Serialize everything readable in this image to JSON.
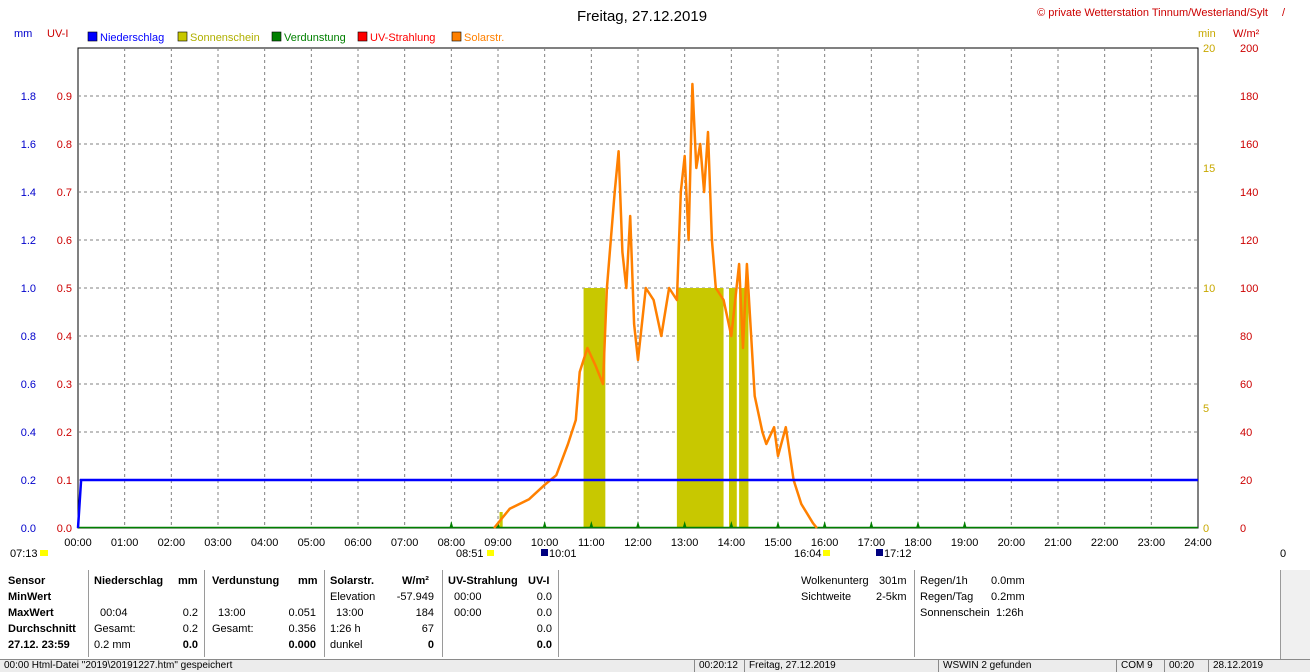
{
  "title": "Freitag, 27.12.2019",
  "copyright": "© private Wetterstation Tinnum/Westerland/Sylt",
  "corner_marker": "/",
  "axis_units": {
    "left1": "mm",
    "left2": "UV-I",
    "right1": "min",
    "right2": "W/m²"
  },
  "legend": [
    {
      "label": "Niederschlag",
      "color": "#0000ff"
    },
    {
      "label": "Sonnenschein",
      "color": "#c8c800"
    },
    {
      "label": "Verdunstung",
      "color": "#008000"
    },
    {
      "label": "UV-Strahlung",
      "color": "#ff0000"
    },
    {
      "label": "Solarstr.",
      "color": "#ff8000"
    }
  ],
  "sun_markers": {
    "left": "07:13",
    "right": "0",
    "sunrise": "08:51",
    "uv_start": "10:01",
    "sunset": "16:04",
    "uv_end": "17:12"
  },
  "chart_data": {
    "type": "line",
    "x_ticks": [
      "00:00",
      "01:00",
      "02:00",
      "03:00",
      "04:00",
      "05:00",
      "06:00",
      "07:00",
      "08:00",
      "09:00",
      "10:00",
      "11:00",
      "12:00",
      "13:00",
      "14:00",
      "15:00",
      "16:00",
      "17:00",
      "18:00",
      "19:00",
      "20:00",
      "21:00",
      "22:00",
      "23:00",
      "24:00"
    ],
    "y_mm_ticks": [
      "0.0",
      "0.2",
      "0.4",
      "0.6",
      "0.8",
      "1.0",
      "1.2",
      "1.4",
      "1.6",
      "1.8"
    ],
    "y_uv_ticks": [
      "0.0",
      "0.1",
      "0.2",
      "0.3",
      "0.4",
      "0.5",
      "0.6",
      "0.7",
      "0.8",
      "0.9"
    ],
    "y_min_ticks": [
      "0",
      "5",
      "10",
      "15",
      "20"
    ],
    "y_wm2_ticks": [
      "0",
      "20",
      "40",
      "60",
      "80",
      "100",
      "120",
      "140",
      "160",
      "180",
      "200"
    ],
    "ylim_mm": [
      0,
      2.0
    ],
    "ylim_uv": [
      0,
      1.0
    ],
    "ylim_min": [
      0,
      20
    ],
    "ylim_wm2": [
      0,
      200
    ],
    "grid": true,
    "series": [
      {
        "name": "Niederschlag",
        "color": "#0000ff",
        "x": [
          "00:00",
          "00:04",
          "24:00"
        ],
        "y": [
          0.0,
          0.2,
          0.2
        ]
      },
      {
        "name": "Solarstr.",
        "color": "#ff8000",
        "x": [
          "08:55",
          "09:15",
          "09:40",
          "10:00",
          "10:15",
          "10:30",
          "10:40",
          "10:45",
          "10:55",
          "11:05",
          "11:15",
          "11:20",
          "11:30",
          "11:35",
          "11:40",
          "11:45",
          "11:50",
          "11:55",
          "12:00",
          "12:10",
          "12:20",
          "12:30",
          "12:40",
          "12:50",
          "12:55",
          "13:00",
          "13:05",
          "13:10",
          "13:15",
          "13:20",
          "13:25",
          "13:30",
          "13:35",
          "13:40",
          "13:50",
          "14:00",
          "14:10",
          "14:15",
          "14:20",
          "14:30",
          "14:40",
          "14:45",
          "14:55",
          "15:00",
          "15:10",
          "15:20",
          "15:30",
          "15:45",
          "15:50"
        ],
        "y": [
          0,
          8,
          12,
          18,
          22,
          35,
          45,
          65,
          75,
          68,
          60,
          100,
          140,
          157,
          115,
          100,
          130,
          85,
          70,
          100,
          95,
          80,
          100,
          95,
          140,
          155,
          120,
          185,
          150,
          160,
          140,
          165,
          120,
          100,
          95,
          80,
          110,
          75,
          110,
          55,
          40,
          35,
          42,
          30,
          42,
          20,
          10,
          2,
          0
        ]
      },
      {
        "name": "Sonnenschein",
        "color": "#c8c800",
        "blocks": [
          [
            "10:50",
            "11:18"
          ],
          [
            "12:50",
            "13:50"
          ],
          [
            "13:57",
            "14:07"
          ],
          [
            "14:10",
            "14:22"
          ],
          [
            "09:02",
            "09:06"
          ]
        ],
        "value_min": 10
      },
      {
        "name": "Verdunstung",
        "color": "#008000",
        "x": [
          "00:00",
          "08:45",
          "09:15",
          "24:00"
        ],
        "y": [
          0.0,
          0.0,
          0.0,
          0.0
        ]
      }
    ]
  },
  "stats": {
    "sensor": {
      "title": "Sensor",
      "rows": [
        "MinWert",
        "MaxWert",
        "Durchschnitt",
        "27.12.  23:59"
      ]
    },
    "niederschlag": {
      "title": "Niederschlag",
      "unit": "mm",
      "r1a": "",
      "r1b": "",
      "r2a": "00:04",
      "r2b": "0.2",
      "r3a": "Gesamt:",
      "r3b": "0.2",
      "r4a": "0.2 mm",
      "r4b": "0.0"
    },
    "verdunstung": {
      "title": "Verdunstung",
      "unit": "mm",
      "r1a": "",
      "r1b": "",
      "r2a": "13:00",
      "r2b": "0.051",
      "r3a": "Gesamt:",
      "r3b": "0.356",
      "r4a": "",
      "r4b": "0.000"
    },
    "solar": {
      "title": "Solarstr.",
      "unit": "W/m²",
      "r1a": "Elevation",
      "r1b": "-57.949",
      "r2a": "13:00",
      "r2b": "184",
      "r3a": "1:26 h",
      "r3b": "67",
      "r4a": "dunkel",
      "r4b": "0"
    },
    "uv": {
      "title": "UV-Strahlung",
      "unit": "UV-I",
      "r1a": "00:00",
      "r1b": "0.0",
      "r2a": "00:00",
      "r2b": "0.0",
      "r3a": "",
      "r3b": "0.0",
      "r4a": "",
      "r4b": "0.0"
    },
    "wolken": {
      "l1": "Wolkenunterg",
      "v1": "301m",
      "l2": "Sichtweite",
      "v2": "2-5km"
    },
    "regen": {
      "l1": "Regen/1h",
      "v1": "0.0mm",
      "l2": "Regen/Tag",
      "v2": "0.2mm",
      "l3": "Sonnenschein",
      "v3": "1:26h"
    }
  },
  "statusbar": {
    "s1": "00:00  Html-Datei  \"2019\\20191227.htm\"  gespeichert",
    "s2": "00:20:12",
    "s3": "Freitag, 27.12.2019",
    "s4": "WSWIN 2 gefunden",
    "s5": "COM 9",
    "s6": "00:20",
    "s7": "28.12.2019"
  }
}
